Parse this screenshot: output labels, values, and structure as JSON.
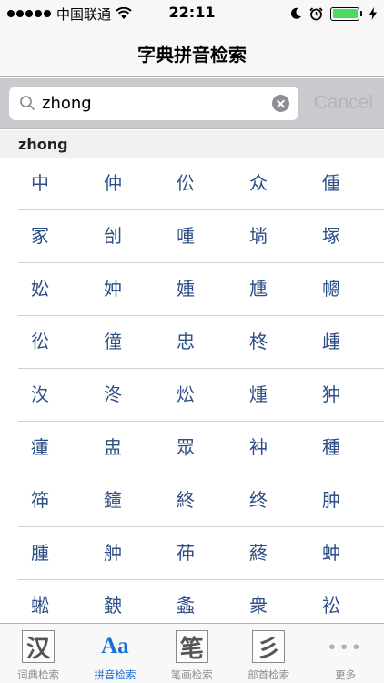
{
  "status_bar": {
    "carrier": "中国联通",
    "time": "22:11",
    "battery_color": "#4cd964"
  },
  "nav": {
    "title": "字典拼音检索"
  },
  "search": {
    "query": "zhong",
    "cancel_label": "Cancel"
  },
  "section": {
    "title": "zhong"
  },
  "characters": [
    [
      "中",
      "仲",
      "伀",
      "众",
      "偅"
    ],
    [
      "冢",
      "刣",
      "喠",
      "埫",
      "塚"
    ],
    [
      "妐",
      "妕",
      "媑",
      "尰",
      "幒"
    ],
    [
      "彸",
      "徸",
      "忠",
      "柊",
      "歱"
    ],
    [
      "汷",
      "泈",
      "炂",
      "煄",
      "狆"
    ],
    [
      "瘇",
      "盅",
      "眾",
      "衶",
      "種"
    ],
    [
      "筗",
      "籦",
      "終",
      "终",
      "肿"
    ],
    [
      "腫",
      "舯",
      "茽",
      "蔠",
      "蚛"
    ],
    [
      "蜙",
      "螤",
      "螽",
      "衆",
      "衳"
    ]
  ],
  "tabs": [
    {
      "label": "词典检索",
      "icon_name": "han-character-icon",
      "glyph": "汉"
    },
    {
      "label": "拼音检索",
      "icon_name": "pinyin-aa-icon",
      "glyph": "Aa"
    },
    {
      "label": "笔画检索",
      "icon_name": "brush-stroke-icon",
      "glyph": "笔"
    },
    {
      "label": "部首检索",
      "icon_name": "radical-icon",
      "glyph": "彡"
    },
    {
      "label": "更多",
      "icon_name": "more-dots-icon",
      "glyph": "•••"
    }
  ],
  "accent_color": "#1a6fd6",
  "character_color": "#2d4e86"
}
